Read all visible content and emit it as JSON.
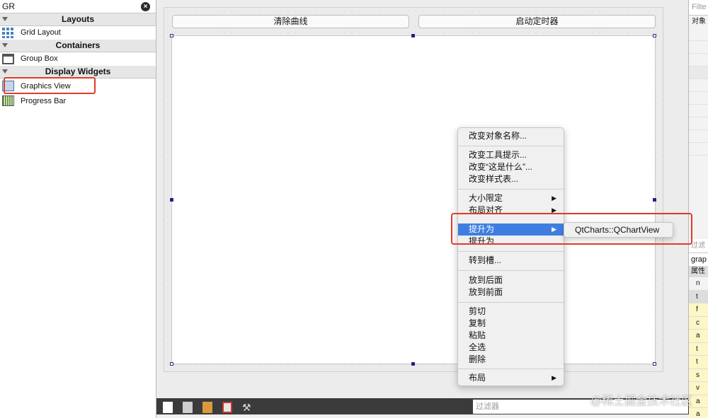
{
  "widgetbox": {
    "filter_value": "GR",
    "clear_glyph": "×",
    "categories": {
      "layouts": "Layouts",
      "containers": "Containers",
      "display_widgets": "Display Widgets"
    },
    "items": {
      "grid_layout": "Grid Layout",
      "group_box": "Group Box",
      "graphics_view": "Graphics View",
      "progress_bar": "Progress Bar"
    }
  },
  "form": {
    "button_clear": "清除曲线",
    "button_timer": "启动定时器"
  },
  "context_menu": {
    "items": [
      {
        "label": "改变对象名称..."
      },
      {
        "label": "改变工具提示..."
      },
      {
        "label": "改变“这是什么”..."
      },
      {
        "label": "改变样式表..."
      },
      {
        "label": "大小限定",
        "arrow": "▶"
      },
      {
        "label": "布局对齐",
        "arrow": "▶"
      },
      {
        "label": "提升为",
        "arrow": "▶"
      },
      {
        "label": "提升为"
      },
      {
        "label": "转到槽..."
      },
      {
        "label": "放到后面"
      },
      {
        "label": "放到前面"
      },
      {
        "label": "剪切"
      },
      {
        "label": "复制"
      },
      {
        "label": "粘贴"
      },
      {
        "label": "全选"
      },
      {
        "label": "删除"
      },
      {
        "label": "布局",
        "arrow": "▶"
      }
    ],
    "selected_color": "#3f7ee0"
  },
  "submenu": {
    "item": "QtCharts::QChartView"
  },
  "right_panel": {
    "filter_placeholder": "Filte",
    "object_header": "对象",
    "filter2_placeholder": "过滤",
    "object_name": "grap",
    "property_header": "属性",
    "property_rows": [
      "n",
      "t",
      "f",
      "c",
      "a",
      "t",
      "t",
      "s",
      "v",
      "a",
      "a"
    ]
  },
  "bottom_bar": {
    "filter_placeholder": "过滤器"
  },
  "highlight_color": "#e03a2a",
  "watermark": "@稀土掘金技术社区"
}
